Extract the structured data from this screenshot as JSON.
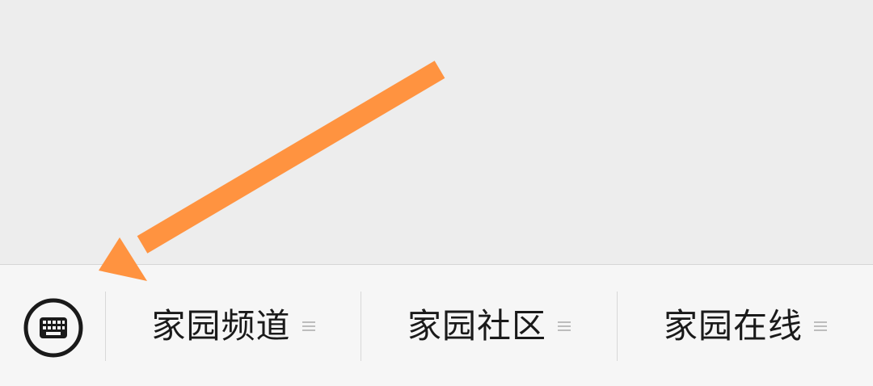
{
  "menu": {
    "items": [
      {
        "label": "家园频道",
        "icon": "list-icon"
      },
      {
        "label": "家园社区",
        "icon": "list-icon"
      },
      {
        "label": "家园在线",
        "icon": "list-icon"
      }
    ]
  },
  "keyboard": {
    "icon": "keyboard-icon"
  },
  "annotation": {
    "color": "#ff9340"
  },
  "colors": {
    "background": "#ededed",
    "menu_bar": "#f6f6f6",
    "text": "#1a1a1a",
    "icon": "#1a1a1a",
    "divider": "#d8d8d8"
  }
}
